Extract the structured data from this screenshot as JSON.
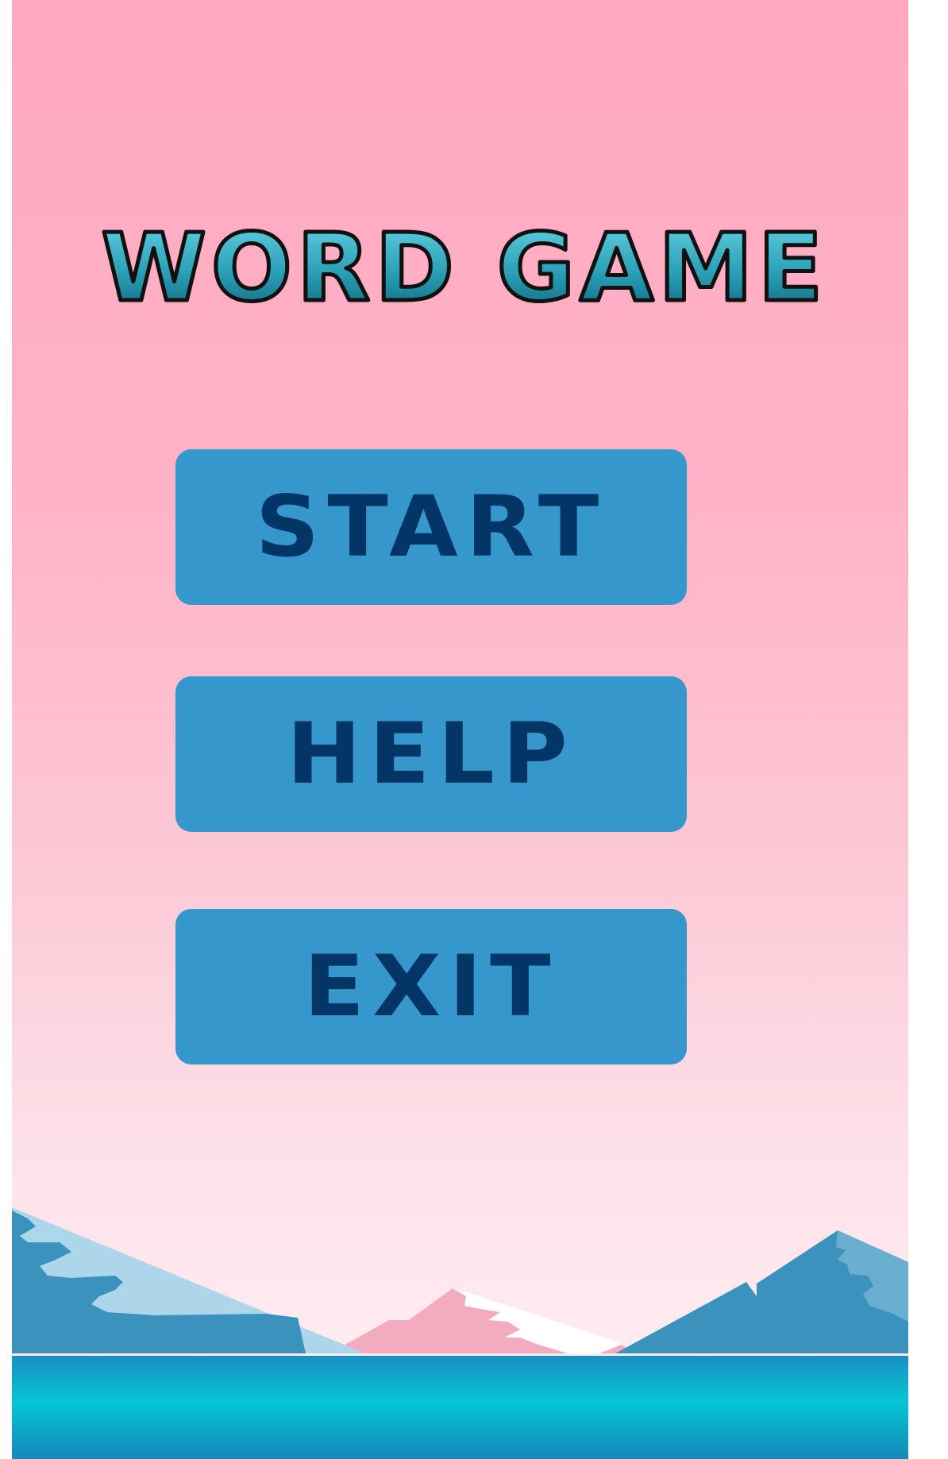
{
  "title": "WORD GAME",
  "menu": {
    "start_label": "START",
    "help_label": "HELP",
    "exit_label": "EXIT"
  },
  "colors": {
    "background_top": "#ffa8c0",
    "background_bottom": "#fff2f5",
    "button": "#3597cb",
    "button_text": "#043567",
    "title_fill_top": "#5fd0e0",
    "title_fill_bottom": "#0a6b80",
    "water": "#12b6cc"
  }
}
